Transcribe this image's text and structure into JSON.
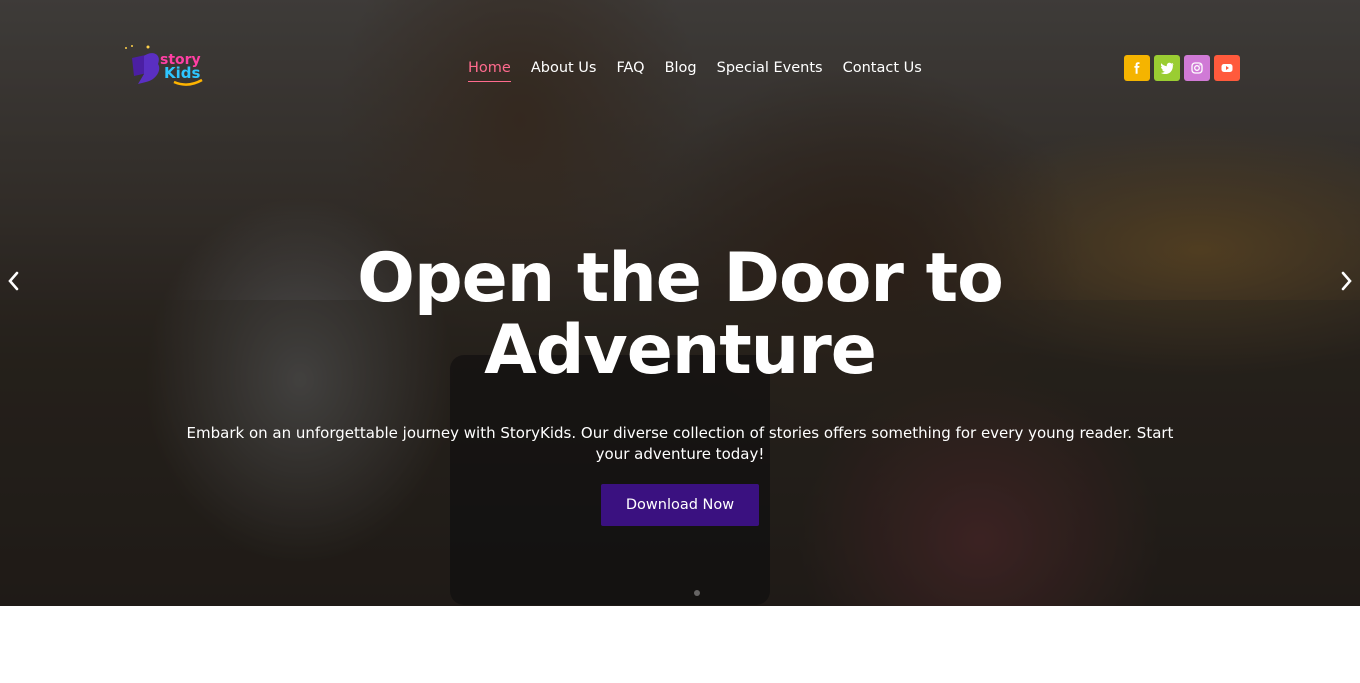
{
  "brand": {
    "logo_top": "story",
    "logo_bottom": "Kids"
  },
  "nav": {
    "items": [
      {
        "label": "Home",
        "active": true
      },
      {
        "label": "About Us",
        "active": false
      },
      {
        "label": "FAQ",
        "active": false
      },
      {
        "label": "Blog",
        "active": false
      },
      {
        "label": "Special Events",
        "active": false
      },
      {
        "label": "Contact Us",
        "active": false
      }
    ],
    "active_color": "#ff6b8e"
  },
  "social": [
    {
      "name": "facebook-icon",
      "glyph": "f",
      "color": "#f5b400"
    },
    {
      "name": "twitter-icon",
      "glyph": "t",
      "color": "#9acd32"
    },
    {
      "name": "instagram-icon",
      "glyph": "i",
      "color": "#d07ad6"
    },
    {
      "name": "youtube-icon",
      "glyph": "y",
      "color": "#ff5a3c"
    }
  ],
  "hero": {
    "headline_line1": "Open the Door to",
    "headline_line2": "Adventure",
    "subtitle": "Embark on an unforgettable journey with StoryKids. Our diverse collection of stories offers something for every young reader. Start your adventure today!",
    "cta_label": "Download Now",
    "cta_color": "#3a1180"
  },
  "carousel": {
    "prev_icon": "chevron-left-icon",
    "next_icon": "chevron-right-icon"
  }
}
